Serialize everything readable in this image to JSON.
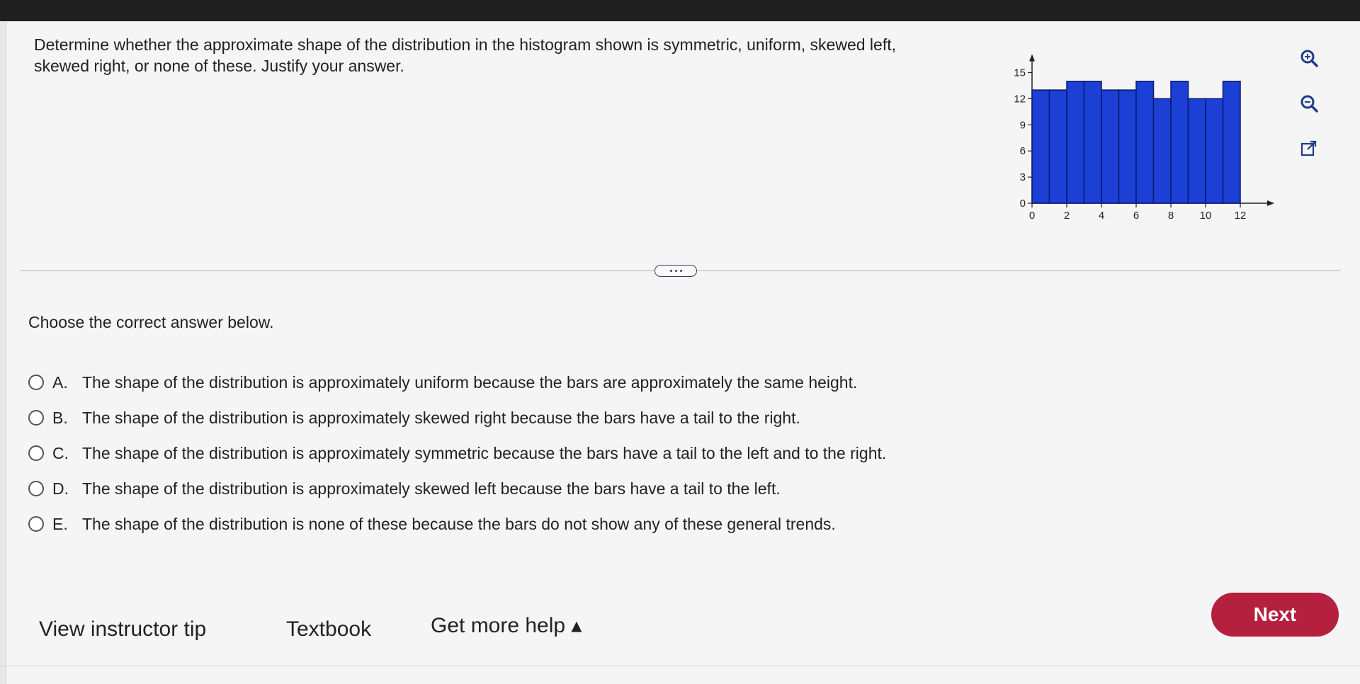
{
  "question": {
    "text": "Determine whether the approximate shape of the distribution in the histogram shown is symmetric, uniform, skewed left, skewed right, or none of these. Justify your answer."
  },
  "chart_data": {
    "type": "bar",
    "x_edges": [
      0,
      1,
      2,
      3,
      4,
      5,
      6,
      7,
      8,
      9,
      10,
      11,
      12
    ],
    "values": [
      13,
      13,
      14,
      14,
      13,
      13,
      14,
      12,
      14,
      12,
      12,
      14
    ],
    "xticks": [
      "0",
      "2",
      "4",
      "6",
      "8",
      "10",
      "12"
    ],
    "yticks": [
      "0",
      "3",
      "6",
      "9",
      "12",
      "15"
    ],
    "ylim": [
      0,
      15
    ],
    "xlim": [
      0,
      12
    ],
    "grid": false,
    "bar_color": "#1c3fd6",
    "bar_edge_color": "#0a1a6e"
  },
  "tools": {
    "zoom_in": "zoom-in-icon",
    "zoom_out": "zoom-out-icon",
    "popout": "popout-icon"
  },
  "prompt": "Choose the correct answer below.",
  "options": [
    {
      "letter": "A.",
      "text": "The shape of the distribution is approximately uniform because the bars are approximately the same height."
    },
    {
      "letter": "B.",
      "text": "The shape of the distribution is approximately skewed right because the bars have a tail to the right."
    },
    {
      "letter": "C.",
      "text": "The shape of the distribution is approximately symmetric because the bars have a tail to the left and to the right."
    },
    {
      "letter": "D.",
      "text": "The shape of the distribution is approximately skewed left because the bars have a tail to the left."
    },
    {
      "letter": "E.",
      "text": "The shape of the distribution is none of these because the bars do not show any of these general trends."
    }
  ],
  "footer": {
    "instructor_tip": "View instructor tip",
    "textbook": "Textbook",
    "more_help": "Get more help ▴",
    "next": "Next"
  },
  "colors": {
    "accent": "#b5203f",
    "bar": "#1c3fd6"
  }
}
